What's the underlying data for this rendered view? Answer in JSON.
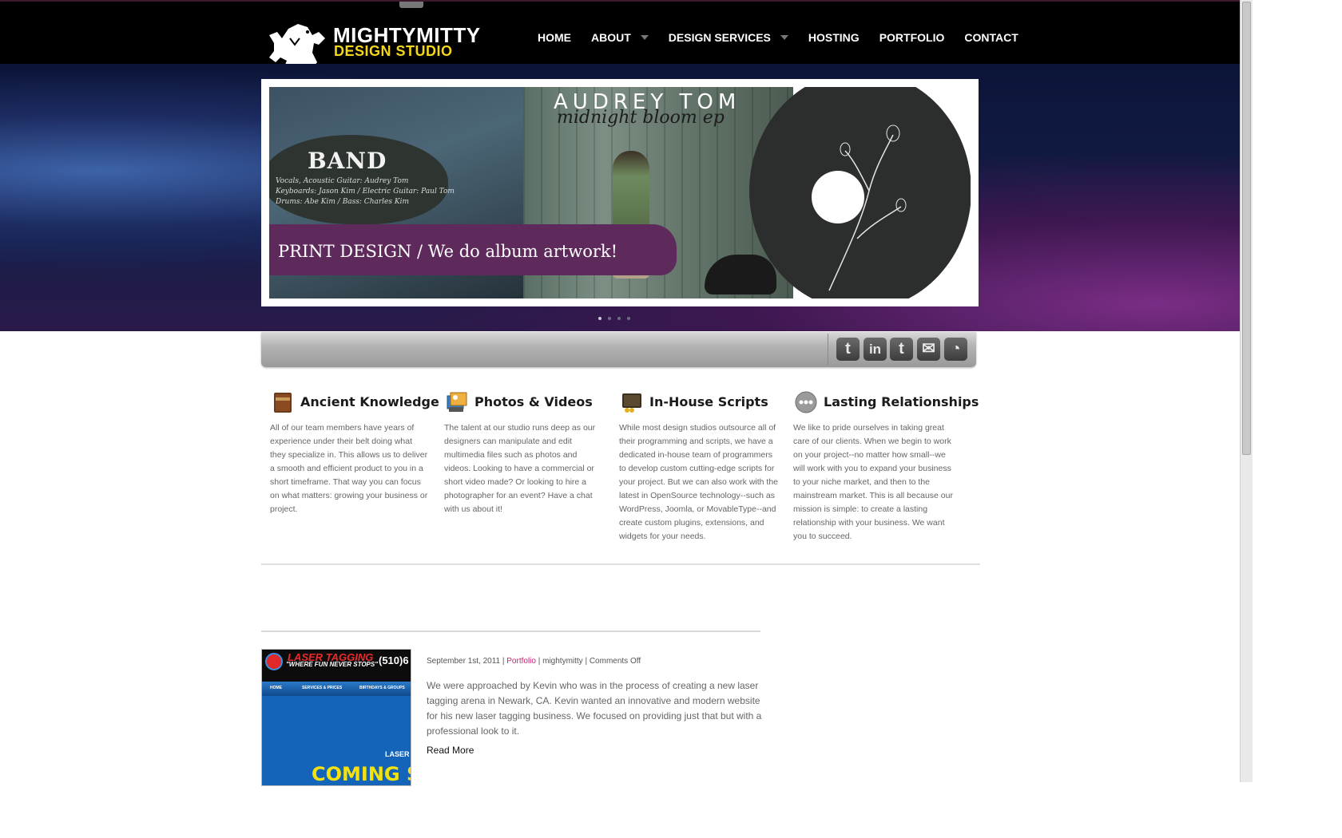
{
  "site": {
    "logo_line1": "MIGHTYMITTY",
    "logo_line2": "DESIGN STUDIO",
    "brand_color": "#f4d61a"
  },
  "nav": {
    "items": [
      {
        "label": "HOME"
      },
      {
        "label": "ABOUT"
      },
      {
        "label": "DESIGN SERVICES"
      },
      {
        "label": "HOSTING"
      },
      {
        "label": "PORTFOLIO"
      },
      {
        "label": "CONTACT"
      }
    ]
  },
  "slider": {
    "band_title": "BAND",
    "band_credits": [
      "Vocals, Acoustic Guitar: Audrey Tom",
      "Keyboards: Jason Kim / Electric Guitar: Paul Tom",
      "Drums: Abe Kim / Bass: Charles Kim"
    ],
    "artist": "AUDREY TOM",
    "album": "midnight bloom ep",
    "caption": "PRINT DESIGN / We do album artwork!",
    "accent_color": "#5e2a5c",
    "active_slide": 1,
    "total_slides": 4
  },
  "social": {
    "icons": [
      "twitter-icon",
      "linkedin-icon",
      "tumblr-icon",
      "email-icon",
      "rss-icon"
    ],
    "glyphs": [
      "t",
      "in",
      "t",
      "✉",
      "◔"
    ]
  },
  "features": [
    {
      "title": "Ancient Knowledge",
      "text": "All of our team members have years of experience under their belt doing what they specialize in. This allows us to deliver a smooth and efficient product to you in a short timeframe. That way you can focus on what matters: growing your business or project."
    },
    {
      "title": "Photos & Videos",
      "text": "The talent at our studio runs deep as our designers can manipulate and edit multimedia files such as photos and videos. Looking to have a commercial or short video made? Or looking to hire a photographer for an event? Have a chat with us about it!"
    },
    {
      "title": "In-House Scripts",
      "text": "While most design studios outsource all of their programming and scripts, we have a dedicated in-house team of programmers to develop custom cutting-edge scripts for your project. But we can also work with the latest in OpenSource technology--such as WordPress, Joomla, or MovableType--and create custom plugins, extensions, and widgets for your needs."
    },
    {
      "title": "Lasting Relationships",
      "text": "We like to pride ourselves in taking great care of our clients. When we begin to work on your project--no matter how small--we will work with you to expand your business to your niche market, and then to the mainstream market. This is all because our mission is simple: to create a lasting relationship with your business. We want you to succeed."
    }
  ],
  "post": {
    "date": "September 1st, 2011",
    "category": "Portfolio",
    "author": "mightymitty",
    "comments": "Comments Off",
    "body": "We were approached by Kevin who was in the process of creating a new laser tagging arena in Newark, CA. Kevin wanted an innovative and modern website for his new laser tagging business. We focused on providing just that but with a professional look to it.",
    "read_more": "Read More",
    "category_color": "#cc1f70",
    "thumb": {
      "brand": "LASER TAGGING",
      "tagline": "\"WHERE FUN NEVER STOPS\"",
      "phone": "(510)6",
      "nav": [
        "HOME",
        "SERVICES & PRICES",
        "BIRTHDAYS & GROUPS"
      ],
      "headline": "LASER T",
      "coming": "COMING S"
    }
  }
}
